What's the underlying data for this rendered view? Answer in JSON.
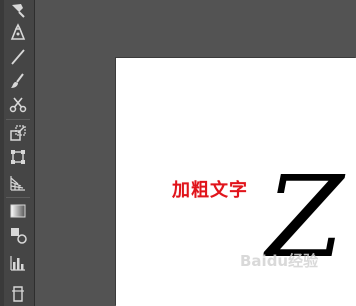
{
  "toolbar": {
    "tools": [
      {
        "name": "eyedropper-icon"
      },
      {
        "name": "pen-tool-icon"
      },
      {
        "name": "line-segment-tool-icon"
      },
      {
        "name": "paintbrush-tool-icon"
      },
      {
        "name": "scissors-tool-icon"
      },
      {
        "name": "scale-tool-icon"
      },
      {
        "name": "free-transform-tool-icon"
      },
      {
        "name": "perspective-grid-tool-icon"
      },
      {
        "name": "gradient-tool-icon"
      },
      {
        "name": "blend-tool-icon"
      },
      {
        "name": "column-graph-tool-icon"
      },
      {
        "name": "artboard-tool-icon"
      }
    ]
  },
  "canvas": {
    "text_label": "加粗文字",
    "text_color": "#e0141b",
    "glyph": "Z"
  },
  "watermark": {
    "text": "Baidu经验"
  }
}
